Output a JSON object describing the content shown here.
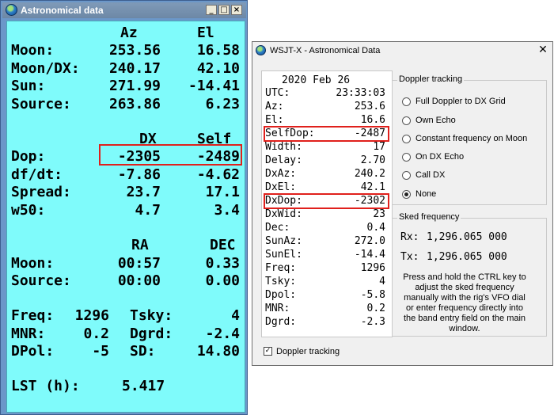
{
  "left_window": {
    "title": "Astronomical data",
    "controls": {
      "minimize": "_",
      "maximize": "□",
      "close": "×"
    },
    "col_headers": {
      "az": "Az",
      "el": "El"
    },
    "rows_top": [
      {
        "label": "Moon:",
        "az": "253.56",
        "el": "16.58"
      },
      {
        "label": "Moon/DX:",
        "az": "240.17",
        "el": "42.10"
      },
      {
        "label": "Sun:",
        "az": "271.99",
        "el": "-14.41"
      },
      {
        "label": "Source:",
        "az": "263.86",
        "el": "6.23"
      }
    ],
    "col_headers2": {
      "dx": "DX",
      "self": "Self"
    },
    "rows_mid": [
      {
        "label": "Dop:",
        "dx": "-2305",
        "self": "-2489"
      },
      {
        "label": "df/dt:",
        "dx": "-7.86",
        "self": "-4.62"
      },
      {
        "label": "Spread:",
        "dx": "23.7",
        "self": "17.1"
      },
      {
        "label": "w50:",
        "dx": "4.7",
        "self": "3.4"
      }
    ],
    "col_headers3": {
      "ra": "RA",
      "dec": "DEC"
    },
    "rows_radec": [
      {
        "label": "Moon:",
        "ra": "00:57",
        "dec": "0.33"
      },
      {
        "label": "Source:",
        "ra": "00:00",
        "dec": "0.00"
      }
    ],
    "misc": {
      "freq_label": "Freq:",
      "freq": "1296",
      "tsky_label": "Tsky:",
      "tsky": "4",
      "mnr_label": "MNR:",
      "mnr": "0.2",
      "dgrd_label": "Dgrd:",
      "dgrd": "-2.4",
      "dpol_label": "DPol:",
      "dpol": "-5",
      "sd_label": "SD:",
      "sd": "14.80"
    },
    "lst_label": "LST (h):",
    "lst": "5.417"
  },
  "right_window": {
    "title": "WSJT-X - Astronomical Data",
    "close": "✕",
    "date": "2020 Feb 26",
    "fields": [
      {
        "label": "UTC:",
        "value": "23:33:03"
      },
      {
        "label": "Az:",
        "value": "253.6"
      },
      {
        "label": "El:",
        "value": "16.6"
      },
      {
        "label": "SelfDop:",
        "value": "-2487"
      },
      {
        "label": "Width:",
        "value": "17"
      },
      {
        "label": "Delay:",
        "value": "2.70"
      },
      {
        "label": "DxAz:",
        "value": "240.2"
      },
      {
        "label": "DxEl:",
        "value": "42.1"
      },
      {
        "label": "DxDop:",
        "value": "-2302"
      },
      {
        "label": "DxWid:",
        "value": "23"
      },
      {
        "label": "Dec:",
        "value": "0.4"
      },
      {
        "label": "SunAz:",
        "value": "272.0"
      },
      {
        "label": "SunEl:",
        "value": "-14.4"
      },
      {
        "label": "Freq:",
        "value": "1296"
      },
      {
        "label": "Tsky:",
        "value": "4"
      },
      {
        "label": "Dpol:",
        "value": "-5.8"
      },
      {
        "label": "MNR:",
        "value": "0.2"
      },
      {
        "label": "Dgrd:",
        "value": "-2.3"
      }
    ],
    "doppler_group": {
      "title": "Doppler tracking",
      "options": [
        {
          "label": "Full Doppler to DX Grid",
          "selected": false
        },
        {
          "label": "Own Echo",
          "selected": false
        },
        {
          "label": "Constant frequency on Moon",
          "selected": false
        },
        {
          "label": "On DX Echo",
          "selected": false
        },
        {
          "label": "Call DX",
          "selected": false
        },
        {
          "label": "None",
          "selected": true
        }
      ]
    },
    "sked_group": {
      "title": "Sked frequency",
      "rx_label": "Rx:",
      "rx": "1,296.065 000",
      "tx_label": "Tx:",
      "tx": "1,296.065 000",
      "note": "Press and hold the CTRL key to adjust the sked frequency manually with the rig's VFO dial or enter frequency directly into the band entry field on the main window."
    },
    "checkbox": {
      "label": "Doppler tracking",
      "checked": true,
      "mark": "✓"
    }
  }
}
